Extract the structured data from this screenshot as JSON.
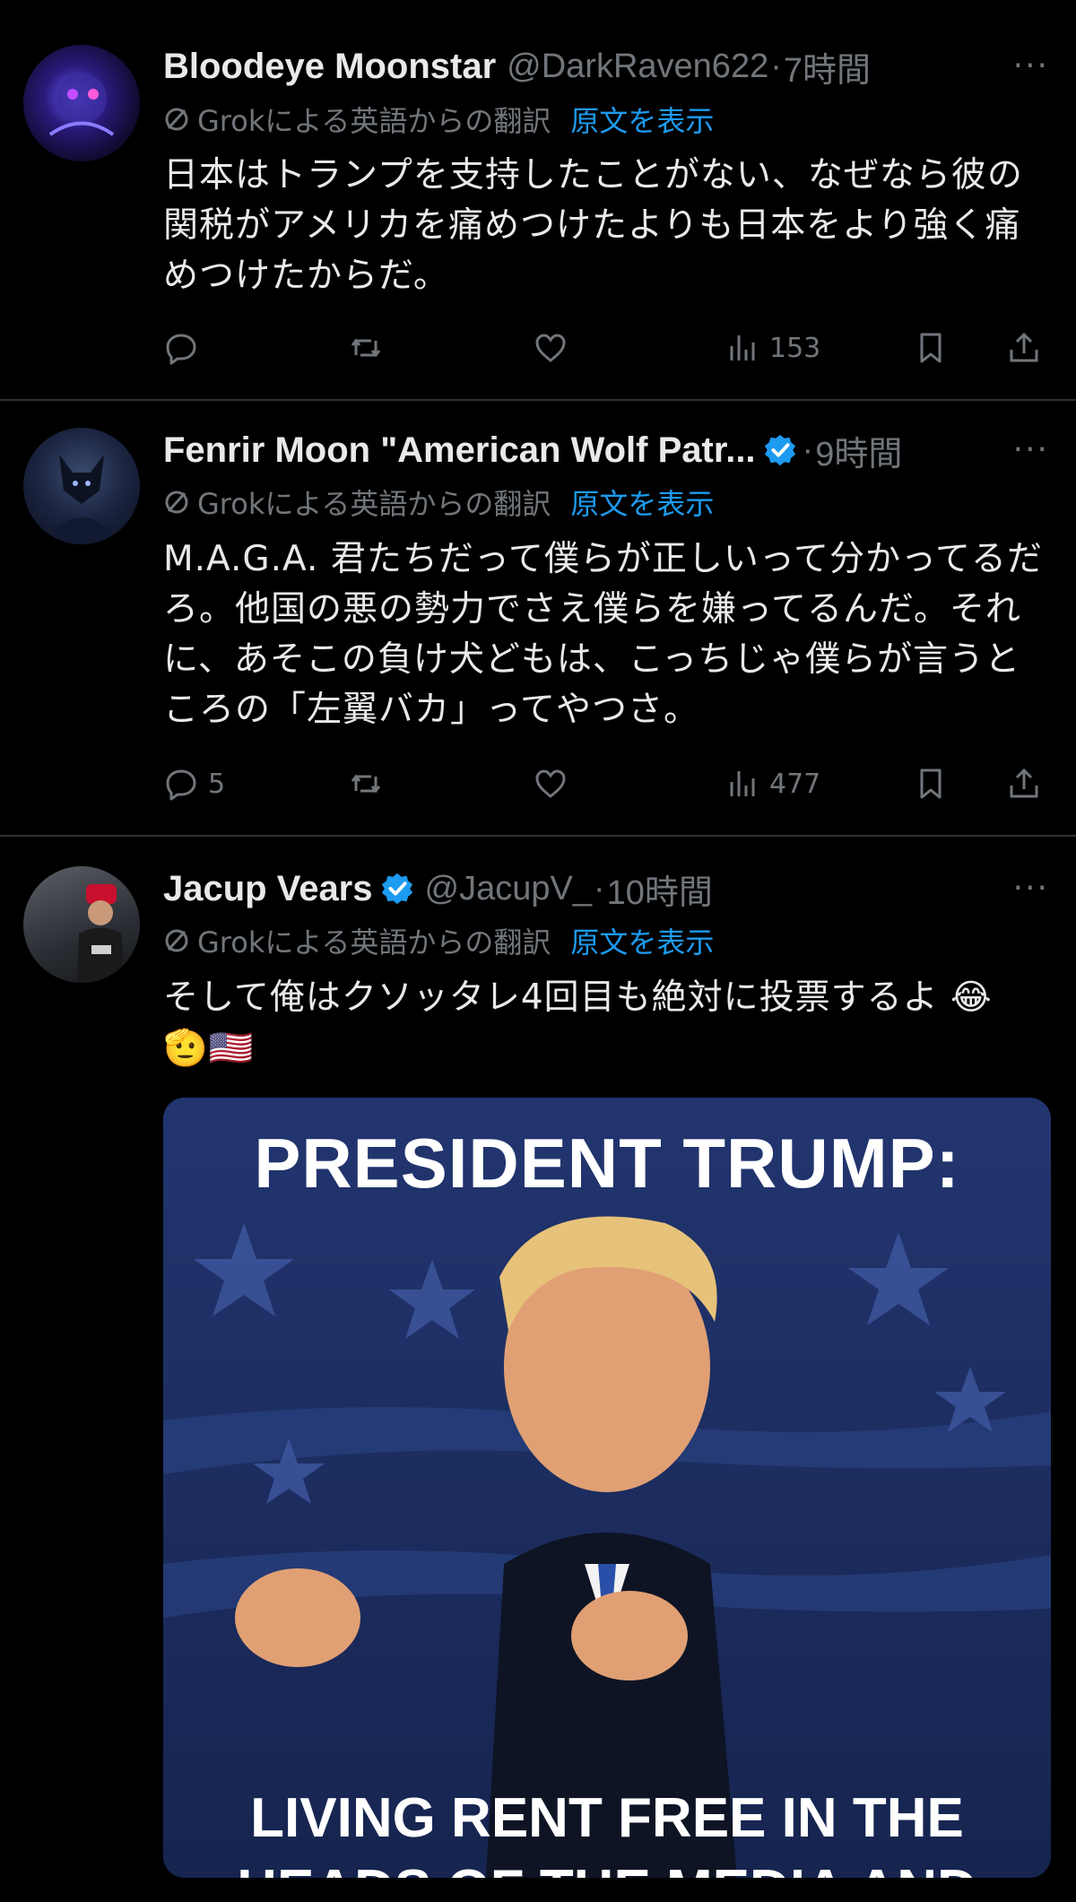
{
  "tweets": [
    {
      "name": "Bloodeye Moonstar",
      "handle": "@DarkRaven622",
      "sep": "·",
      "time": "7時間",
      "translation_label": "Grokによる英語からの翻訳",
      "show_original": "原文を表示",
      "text": "日本はトランプを支持したことがない、なぜなら彼の関税がアメリカを痛めつけたよりも日本をより強く痛めつけたからだ。",
      "reply_count": "",
      "views": "153"
    },
    {
      "name": "Fenrir Moon \"American Wolf Patr...",
      "handle": "",
      "sep": "·",
      "time": "9時間",
      "translation_label": "Grokによる英語からの翻訳",
      "show_original": "原文を表示",
      "text": "M.A.G.A. 君たちだって僕らが正しいって分かってるだろ。他国の悪の勢力でさえ僕らを嫌ってるんだ。それに、あそこの負け犬どもは、こっちじゃ僕らが言うところの「左翼バカ」ってやつさ。",
      "reply_count": "5",
      "views": "477"
    },
    {
      "name": "Jacup Vears",
      "handle": "@JacupV_",
      "sep": "·",
      "time": "10時間",
      "translation_label": "Grokによる英語からの翻訳",
      "show_original": "原文を表示",
      "text": "そして俺はクソッタレ4回目も絶対に投票するよ 😂",
      "text_line2": "🫡🇺🇸",
      "media_top": "PRESIDENT TRUMP:",
      "media_bottom": "LIVING RENT FREE IN THE HEADS OF THE MEDIA AND"
    }
  ],
  "more_label": "···",
  "colors": {
    "background": "#000000",
    "text": "#e7e9ea",
    "muted": "#71767b",
    "link": "#1d9bf0",
    "divider": "#2f3336"
  }
}
